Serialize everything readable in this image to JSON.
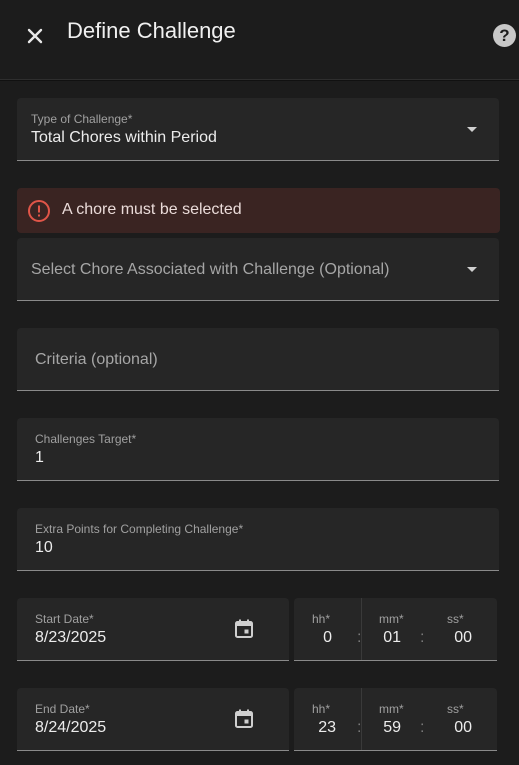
{
  "header": {
    "title": "Define Challenge",
    "close_icon": "close-icon",
    "help_label": "?"
  },
  "challenge_type": {
    "label": "Type of Challenge*",
    "value": "Total Chores within Period"
  },
  "error": {
    "message": "A chore must be selected",
    "icon": "alert-circle-icon",
    "color": "#e05548"
  },
  "chore_select": {
    "placeholder": "Select Chore Associated with Challenge (Optional)"
  },
  "criteria": {
    "placeholder": "Criteria (optional)"
  },
  "challenges_target": {
    "label": "Challenges Target*",
    "value": "1"
  },
  "extra_points": {
    "label": "Extra Points for Completing Challenge*",
    "value": "10"
  },
  "start": {
    "date_label": "Start Date*",
    "date_value": "8/23/2025",
    "hh_label": "hh*",
    "hh_value": "0",
    "mm_label": "mm*",
    "mm_value": "01",
    "ss_label": "ss*",
    "ss_value": "00"
  },
  "end": {
    "date_label": "End Date*",
    "date_value": "8/24/2025",
    "hh_label": "hh*",
    "hh_value": "23",
    "mm_label": "mm*",
    "mm_value": "59",
    "ss_label": "ss*",
    "ss_value": "00"
  },
  "time_separator": ":",
  "colors": {
    "background": "#111111",
    "surface": "#1c1c1c",
    "field": "#262626",
    "error_bg": "#3a2422"
  }
}
